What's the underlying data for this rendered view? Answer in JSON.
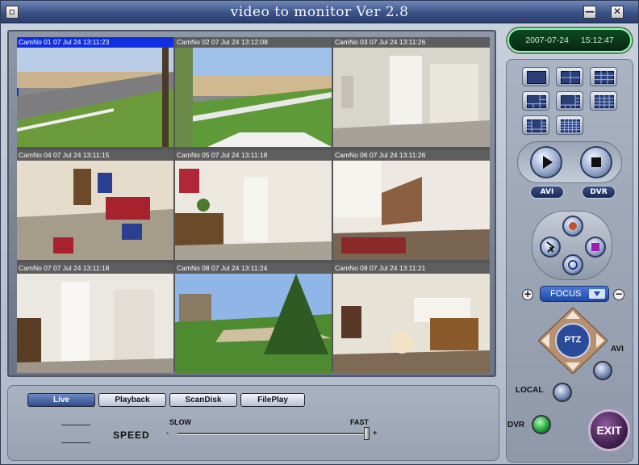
{
  "window": {
    "title": "video to monitor  Ver  2.8",
    "minimize_label": "—",
    "close_label": "✕"
  },
  "cameras": [
    {
      "caption": "CamNo 01 07 Jul 24 13:11:23",
      "selected": true
    },
    {
      "caption": "CamNo 02 07 Jul 24 13:12:08",
      "selected": false
    },
    {
      "caption": "CamNo 03 07 Jul 24 13:11:26",
      "selected": false
    },
    {
      "caption": "CamNo 04 07 Jul 24 13:11:15",
      "selected": false
    },
    {
      "caption": "CamNo 05 07 Jul 24 13:11:18",
      "selected": false
    },
    {
      "caption": "CamNo 06 07 Jul 24 13:11:26",
      "selected": false
    },
    {
      "caption": "CamNo 07 07 Jul 24 13:11:18",
      "selected": false
    },
    {
      "caption": "CamNo 08 07 Jul 24 13:11:24",
      "selected": false
    },
    {
      "caption": "CamNo 09 07 Jul 24 13:11:21",
      "selected": false
    }
  ],
  "clock": {
    "date": "2007-07-24",
    "time": "15:12:47"
  },
  "layouts": [
    {
      "icon": "layout-1x1-icon"
    },
    {
      "icon": "layout-2x2-icon"
    },
    {
      "icon": "layout-3x3-icon"
    },
    {
      "icon": "layout-1plus5-icon"
    },
    {
      "icon": "layout-1plus7-icon"
    },
    {
      "icon": "layout-4x4-icon"
    },
    {
      "icon": "layout-1plus12-icon"
    },
    {
      "icon": "layout-5x5-icon"
    }
  ],
  "playback": {
    "avi_label": "AVI",
    "dvr_label": "DVR"
  },
  "ptz": {
    "focus_label": "FOCUS",
    "plus": "+",
    "minus": "−",
    "center_label": "PTZ"
  },
  "side": {
    "avi_label": "AVI",
    "local_label": "LOCAL",
    "dvr_label": "DVR",
    "exit_label": "EXIT"
  },
  "tabs": [
    {
      "label": "Live",
      "active": true
    },
    {
      "label": "Playback",
      "active": false
    },
    {
      "label": "ScanDisk",
      "active": false
    },
    {
      "label": "FilePlay",
      "active": false
    }
  ],
  "speed": {
    "label": "SPEED",
    "slow_label": "SLOW",
    "fast_label": "FAST",
    "minus": "-",
    "plus": "+",
    "value": 1.0
  },
  "colors": {
    "selected_caption": "#1030e0",
    "title_bar": "#3b5286",
    "clock_bg": "#0d4a22"
  }
}
